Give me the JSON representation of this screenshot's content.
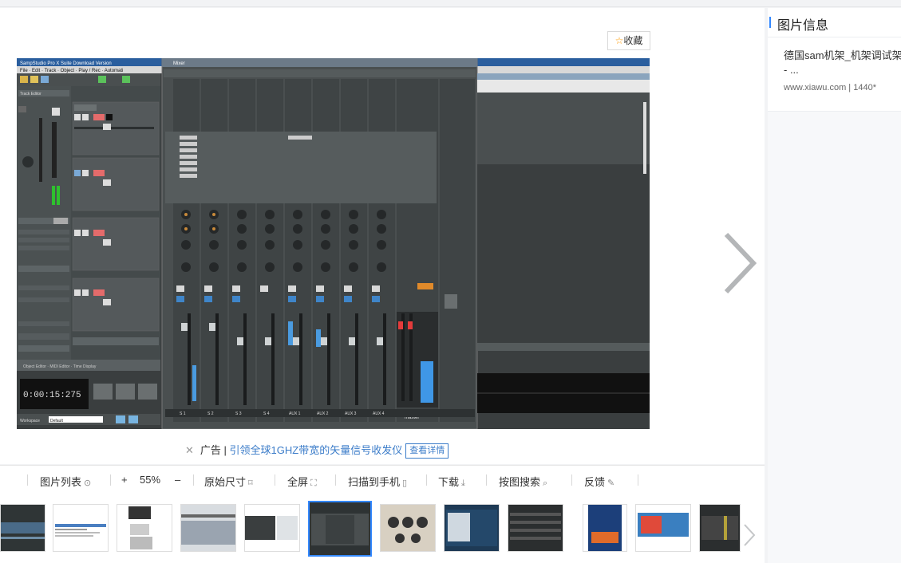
{
  "viewer": {
    "favorite_label": "收藏",
    "ad": {
      "prefix": "广告",
      "text": "引领全球1GHZ带宽的矢量信号收发仪",
      "button": "查看详情"
    },
    "main_image": {
      "daw_title": "SampStudio Pro X Suite Download Version",
      "mixer_title": "Mixer",
      "time_readout": "0:00:15:275",
      "channels": [
        "S 1",
        "S 2",
        "S 3",
        "S 4",
        "AUX 1",
        "AUX 2",
        "AUX 3",
        "AUX 4"
      ],
      "master_label": "master",
      "workspace_label": "Workspace",
      "workspace_value": "Default"
    }
  },
  "sidebar": {
    "title": "图片信息",
    "description": "德国sam机架_机架调试架 - ...",
    "source": "www.xiawu.com",
    "size": "1440*"
  },
  "toolbar": {
    "list": "图片列表",
    "zoom_in": "+",
    "zoom": "55%",
    "zoom_out": "–",
    "original": "原始尺寸",
    "fullscreen": "全屏",
    "scan": "扫描到手机",
    "download": "下载",
    "search": "按图搜索",
    "feedback": "反馈"
  },
  "colors": {
    "accent": "#3388ff",
    "link": "#3b7cc9",
    "star": "#ff9900"
  }
}
